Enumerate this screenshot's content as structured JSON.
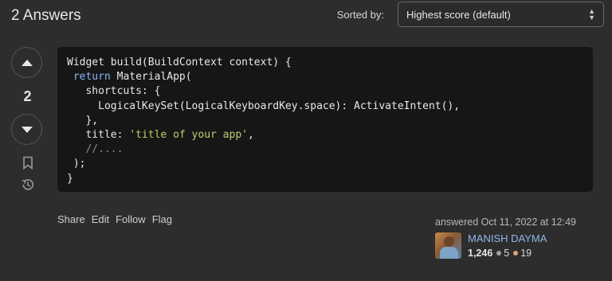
{
  "header": {
    "answers_title": "2 Answers",
    "sorted_label": "Sorted by:",
    "sort_selected": "Highest score (default)"
  },
  "vote": {
    "score": "2"
  },
  "code_lines": [
    "Widget build(BuildContext context) {",
    " return MaterialApp(",
    "   shortcuts: {",
    "     LogicalKeySet(LogicalKeyboardKey.space): ActivateIntent(),",
    "   },",
    "   title: 'title of your app',",
    "   //....",
    " );",
    "}"
  ],
  "code_tokens": {
    "l1": "Widget build(BuildContext context) {",
    "l2_kw": "return",
    "l2_rest": " MaterialApp(",
    "l3": "   shortcuts: {",
    "l4": "     LogicalKeySet(LogicalKeyboardKey.space): ActivateIntent(),",
    "l5": "   },",
    "l6_key": "   title: ",
    "l6_str": "'title of your app'",
    "l6_end": ",",
    "l7": "//....",
    "l8": " );",
    "l9": "}"
  },
  "post_menu": {
    "share": "Share",
    "edit": "Edit",
    "follow": "Follow",
    "flag": "Flag"
  },
  "user_card": {
    "answered": "answered Oct 11, 2022 at 12:49",
    "username": "MANISH DAYMA",
    "reputation": "1,246",
    "silver_badges": "5",
    "bronze_badges": "19"
  },
  "icons": {
    "upvote": "upvote-arrow-icon",
    "downvote": "downvote-arrow-icon",
    "bookmark": "bookmark-icon",
    "history": "history-icon",
    "sort_chevron": "chevron-up-down-icon"
  },
  "colors": {
    "background": "#2d2d2d",
    "code_background": "#161616",
    "keyword": "#8ab4f8",
    "string": "#c4cc6e",
    "username": "#8fb8e8"
  }
}
